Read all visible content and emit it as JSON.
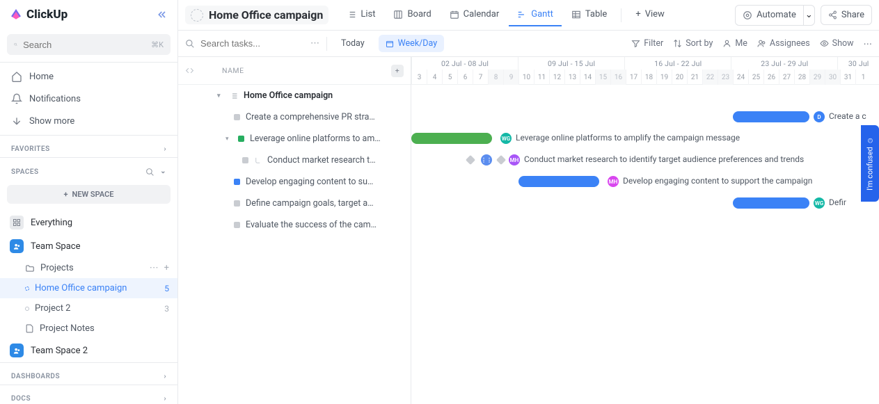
{
  "app": {
    "name": "ClickUp",
    "search_placeholder": "Search",
    "search_shortcut": "⌘K"
  },
  "nav": {
    "home": "Home",
    "notifications": "Notifications",
    "show_more": "Show more"
  },
  "sections": {
    "favorites": "FAVORITES",
    "spaces": "SPACES",
    "dashboards": "DASHBOARDS",
    "docs": "DOCS"
  },
  "new_space": "NEW SPACE",
  "spaces": {
    "everything": "Everything",
    "team_space": "Team Space",
    "projects": "Projects",
    "home_office": "Home Office campaign",
    "home_office_count": "5",
    "project2": "Project 2",
    "project2_count": "3",
    "project_notes": "Project Notes",
    "team_space2": "Team Space 2"
  },
  "page": {
    "title": "Home Office campaign"
  },
  "views": {
    "list": "List",
    "board": "Board",
    "calendar": "Calendar",
    "gantt": "Gantt",
    "table": "Table",
    "add_view": "View"
  },
  "actions": {
    "automate": "Automate",
    "share": "Share"
  },
  "toolbar": {
    "search_placeholder": "Search tasks...",
    "today": "Today",
    "week_day": "Week/Day",
    "filter": "Filter",
    "sort": "Sort by",
    "me": "Me",
    "assignees": "Assignees",
    "show": "Show"
  },
  "columns": {
    "name": "NAME"
  },
  "weeks": [
    "02 Jul - 08 Jul",
    "09 Jul - 15 Jul",
    "16 Jul - 22 Jul",
    "23 Jul - 29 Jul",
    "30 Jul"
  ],
  "days": [
    "3",
    "4",
    "5",
    "6",
    "7",
    "8",
    "9",
    "10",
    "11",
    "12",
    "13",
    "14",
    "15",
    "16",
    "17",
    "18",
    "19",
    "20",
    "21",
    "22",
    "23",
    "24",
    "25",
    "26",
    "27",
    "28",
    "29",
    "30",
    "31",
    "1"
  ],
  "weekend_idx": [
    5,
    6,
    12,
    13,
    19,
    20,
    26,
    27
  ],
  "tasks": {
    "root": "Home Office campaign",
    "t1": "Create a comprehensive PR stra…",
    "t2": "Leverage online platforms to am…",
    "t3": "Conduct market research t…",
    "t4": "Develop engaging content to su…",
    "t5": "Define campaign goals, target a…",
    "t6": "Evaluate the success of the cam…"
  },
  "ganttlabels": {
    "t1": "Create a c",
    "t2": "Leverage online platforms to amplify the campaign message",
    "t3": "Conduct market research to identify target audience preferences and trends",
    "t4": "Develop engaging content to support the campaign",
    "t5": "Defir"
  },
  "avatars": {
    "wg": "WG",
    "mh": "MH",
    "d": "D"
  },
  "confused": "I'm confused"
}
